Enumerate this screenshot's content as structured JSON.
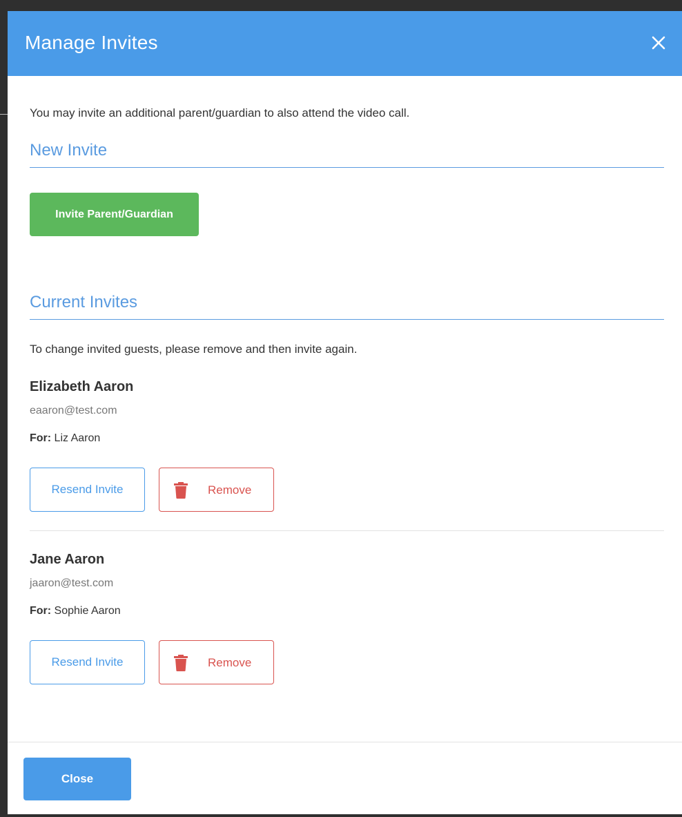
{
  "modal": {
    "title": "Manage Invites",
    "close_icon": "close-icon"
  },
  "intro_text": "You may invite an additional parent/guardian to also attend the video call.",
  "new_invite": {
    "heading": "New Invite",
    "button_label": "Invite Parent/Guardian"
  },
  "current_invites": {
    "heading": "Current Invites",
    "note": "To change invited guests, please remove and then invite again.",
    "items": [
      {
        "name": "Elizabeth Aaron",
        "email": "eaaron@test.com",
        "for_label": "For:",
        "for_value": " Liz Aaron",
        "resend_label": "Resend Invite",
        "remove_label": "Remove",
        "remove_icon": "trash-icon"
      },
      {
        "name": "Jane Aaron",
        "email": "jaaron@test.com",
        "for_label": "For:",
        "for_value": " Sophie Aaron",
        "resend_label": "Resend Invite",
        "remove_label": "Remove",
        "remove_icon": "trash-icon"
      }
    ]
  },
  "footer": {
    "close_label": "Close"
  },
  "colors": {
    "header_bg": "#4a9be8",
    "heading_text": "#5a9be0",
    "success_green": "#5cb85c",
    "danger_red": "#d9534f"
  }
}
